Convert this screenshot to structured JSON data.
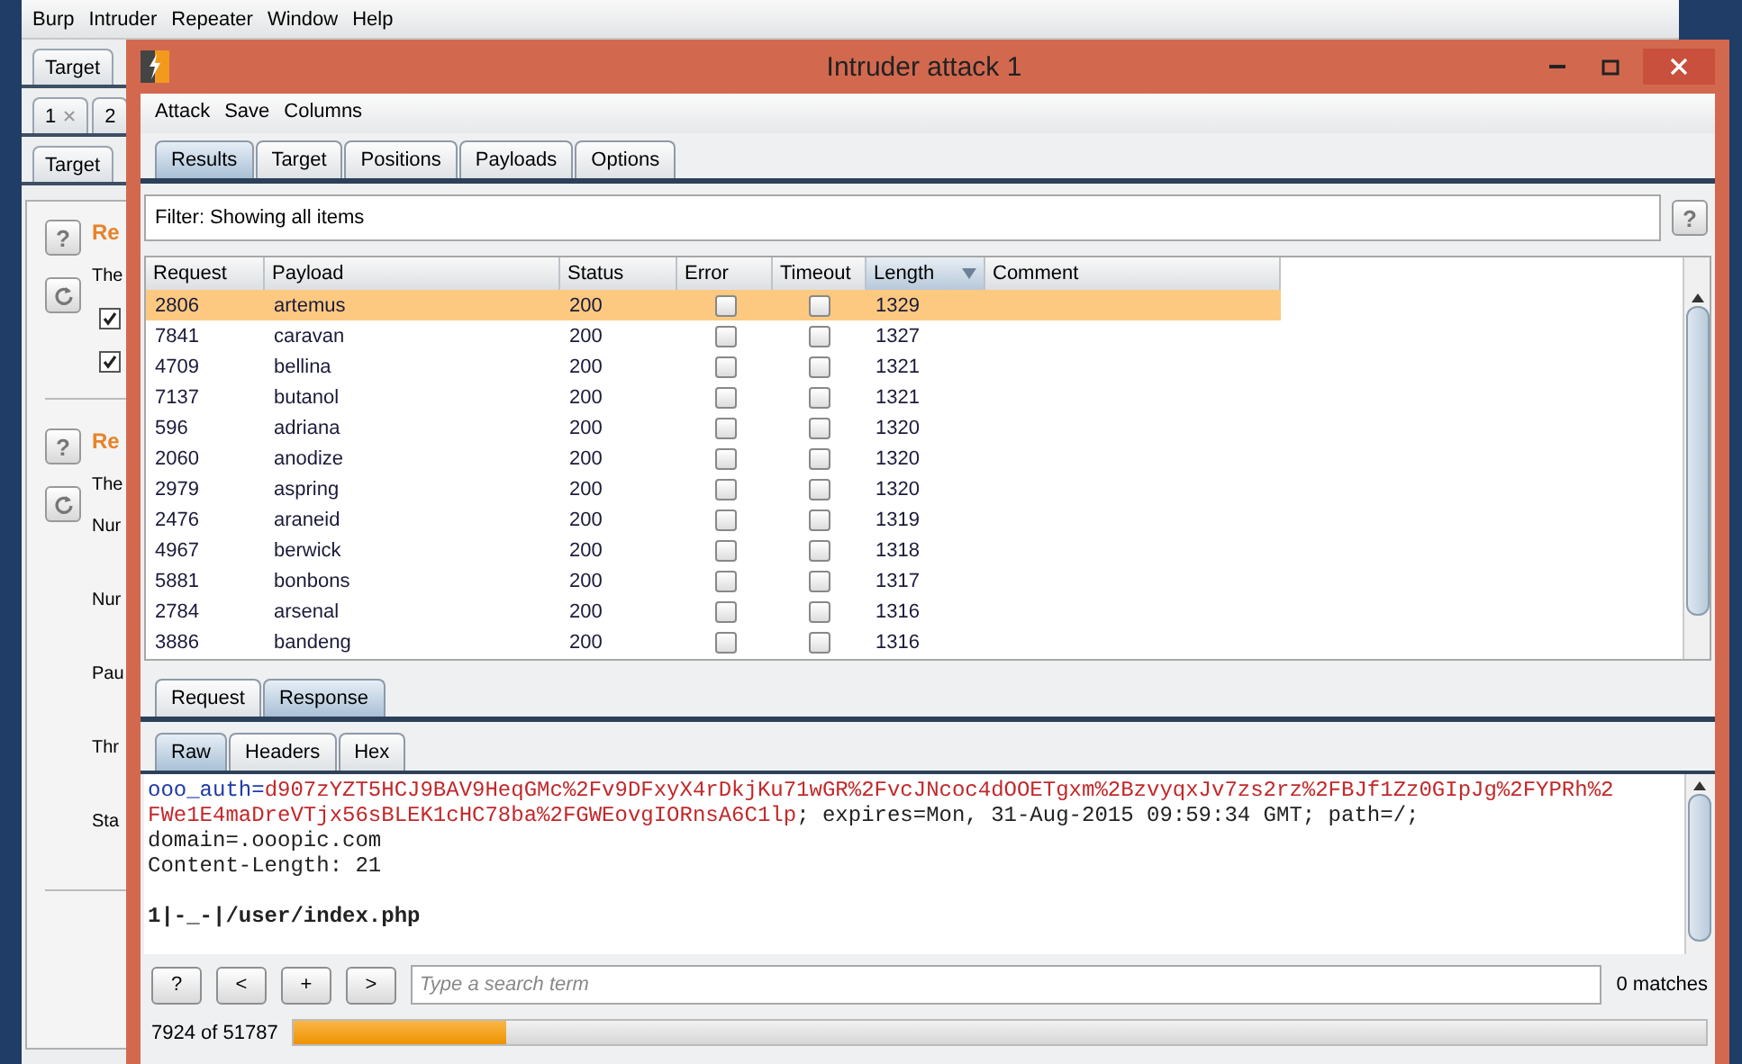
{
  "background_app": {
    "menu": [
      "Burp",
      "Intruder",
      "Repeater",
      "Window",
      "Help"
    ],
    "tab_rows": [
      [
        {
          "label": "Target",
          "closable": false
        }
      ],
      [
        {
          "label": "1",
          "closable": true
        },
        {
          "label": "2",
          "closable": false
        }
      ],
      [
        {
          "label": "Target",
          "closable": false
        }
      ]
    ],
    "sections": [
      {
        "help": "?",
        "heading": "Re",
        "lines": [
          {
            "kind": "text",
            "text": "The"
          },
          {
            "kind": "checkbox",
            "checked": true
          },
          {
            "kind": "checkbox",
            "checked": true
          }
        ]
      },
      {
        "help": "?",
        "heading": "Re",
        "lines": [
          {
            "kind": "text",
            "text": "The"
          },
          {
            "kind": "text",
            "text": "Nur"
          },
          {
            "kind": "text",
            "text": "Nur"
          },
          {
            "kind": "text",
            "text": "Pau"
          },
          {
            "kind": "text",
            "text": "Thr"
          },
          {
            "kind": "text",
            "text": "Sta"
          }
        ]
      }
    ]
  },
  "window": {
    "title": "Intruder attack 1"
  },
  "menu": [
    "Attack",
    "Save",
    "Columns"
  ],
  "tabs": [
    {
      "label": "Results",
      "selected": true
    },
    {
      "label": "Target",
      "selected": false
    },
    {
      "label": "Positions",
      "selected": false
    },
    {
      "label": "Payloads",
      "selected": false
    },
    {
      "label": "Options",
      "selected": false
    }
  ],
  "filter": "Filter:  Showing all items",
  "filter_help": "?",
  "table": {
    "columns": [
      {
        "label": "Request",
        "sorted": false
      },
      {
        "label": "Payload",
        "sorted": false
      },
      {
        "label": "Status",
        "sorted": false
      },
      {
        "label": "Error",
        "sorted": false
      },
      {
        "label": "Timeout",
        "sorted": false
      },
      {
        "label": "Length",
        "sorted": true
      },
      {
        "label": "Comment",
        "sorted": false
      }
    ],
    "rows": [
      {
        "request": "2806",
        "payload": "artemus",
        "status": "200",
        "error": false,
        "timeout": false,
        "length": "1329",
        "selected": true
      },
      {
        "request": "7841",
        "payload": "caravan",
        "status": "200",
        "error": false,
        "timeout": false,
        "length": "1327",
        "selected": false
      },
      {
        "request": "4709",
        "payload": "bellina",
        "status": "200",
        "error": false,
        "timeout": false,
        "length": "1321",
        "selected": false
      },
      {
        "request": "7137",
        "payload": "butanol",
        "status": "200",
        "error": false,
        "timeout": false,
        "length": "1321",
        "selected": false
      },
      {
        "request": "596",
        "payload": "adriana",
        "status": "200",
        "error": false,
        "timeout": false,
        "length": "1320",
        "selected": false
      },
      {
        "request": "2060",
        "payload": "anodize",
        "status": "200",
        "error": false,
        "timeout": false,
        "length": "1320",
        "selected": false
      },
      {
        "request": "2979",
        "payload": "aspring",
        "status": "200",
        "error": false,
        "timeout": false,
        "length": "1320",
        "selected": false
      },
      {
        "request": "2476",
        "payload": "araneid",
        "status": "200",
        "error": false,
        "timeout": false,
        "length": "1319",
        "selected": false
      },
      {
        "request": "4967",
        "payload": "berwick",
        "status": "200",
        "error": false,
        "timeout": false,
        "length": "1318",
        "selected": false
      },
      {
        "request": "5881",
        "payload": "bonbons",
        "status": "200",
        "error": false,
        "timeout": false,
        "length": "1317",
        "selected": false
      },
      {
        "request": "2784",
        "payload": "arsenal",
        "status": "200",
        "error": false,
        "timeout": false,
        "length": "1316",
        "selected": false
      },
      {
        "request": "3886",
        "payload": "bandeng",
        "status": "200",
        "error": false,
        "timeout": false,
        "length": "1316",
        "selected": false
      }
    ]
  },
  "message_tabs": [
    {
      "label": "Request",
      "selected": false
    },
    {
      "label": "Response",
      "selected": true
    }
  ],
  "view_tabs": [
    {
      "label": "Raw",
      "selected": true
    },
    {
      "label": "Headers",
      "selected": false
    },
    {
      "label": "Hex",
      "selected": false
    }
  ],
  "response_lines": [
    {
      "bold": false,
      "segments": [
        {
          "kind": "name",
          "text": "ooo_auth="
        },
        {
          "kind": "value",
          "text": "d907zYZT5HCJ9BAV9HeqGMc%2Fv9DFxyX4rDkjKu71wGR%2FvcJNcoc4dOOETgxm%2BzvyqxJv7zs2rz%2FBJf1Zz0GIpJg%2FYPRh%2"
        }
      ]
    },
    {
      "bold": false,
      "segments": [
        {
          "kind": "value",
          "text": "FWe1E4maDreVTjx56sBLEK1cHC78ba%2FGWEovgIORnsA6C1lp"
        },
        {
          "kind": "plain",
          "text": "; expires=Mon, 31-Aug-2015 09:59:34 GMT; path=/;"
        }
      ]
    },
    {
      "bold": false,
      "segments": [
        {
          "kind": "plain",
          "text": "domain=.ooopic.com"
        }
      ]
    },
    {
      "bold": false,
      "segments": [
        {
          "kind": "plain",
          "text": "Content-Length: 21"
        }
      ]
    },
    {
      "bold": true,
      "gap_before": true,
      "segments": [
        {
          "kind": "plain",
          "text": "1|-_-|/user/index.php"
        }
      ]
    }
  ],
  "search": {
    "buttons": [
      "?",
      "<",
      "+",
      ">"
    ],
    "placeholder": "Type a search term",
    "matches": "0 matches"
  },
  "progress": {
    "label": "7924 of 51787",
    "level": 0.15
  }
}
